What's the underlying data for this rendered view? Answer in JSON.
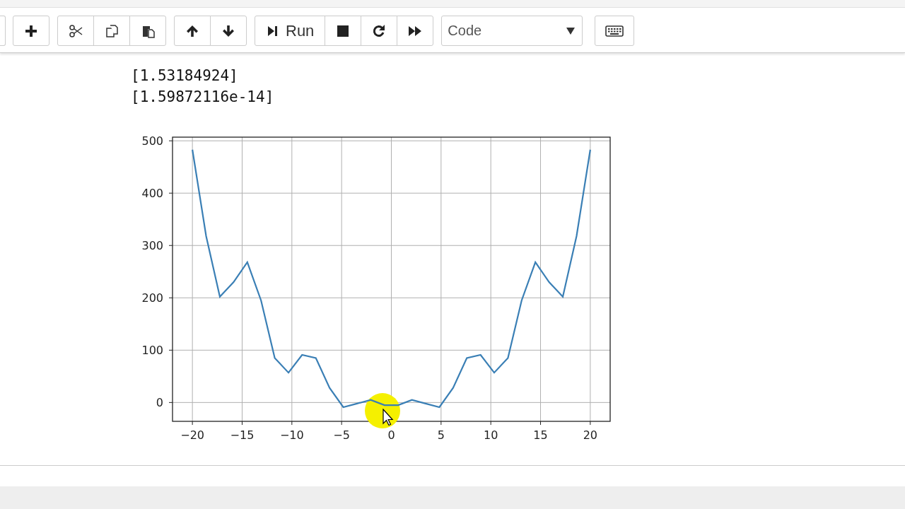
{
  "toolbar": {
    "groups": [
      [
        {
          "kind": "plus"
        }
      ],
      [
        {
          "kind": "cut"
        },
        {
          "kind": "copy"
        },
        {
          "kind": "paste"
        }
      ],
      [
        {
          "kind": "up"
        },
        {
          "kind": "down"
        }
      ],
      [
        {
          "kind": "run",
          "label": "Run"
        },
        {
          "kind": "stop"
        },
        {
          "kind": "restart"
        },
        {
          "kind": "fast-forward"
        }
      ]
    ],
    "cell_type": {
      "value": "Code"
    }
  },
  "output": {
    "lines": [
      "[1.53184924]",
      "[1.59872116e-14]"
    ],
    "chart_data": {
      "type": "line",
      "grid": true,
      "xlim": [
        -22,
        22
      ],
      "ylim": [
        -36,
        507
      ],
      "xticks": [
        {
          "value": -20,
          "label": "−20"
        },
        {
          "value": -15,
          "label": "−15"
        },
        {
          "value": -10,
          "label": "−10"
        },
        {
          "value": -5,
          "label": "−5"
        },
        0,
        5,
        10,
        15,
        20
      ],
      "yticks": [
        0,
        100,
        200,
        300,
        400,
        500
      ],
      "x": [
        -20,
        -18.62,
        -17.24,
        -15.86,
        -14.48,
        -13.1,
        -11.72,
        -10.34,
        -8.97,
        -7.59,
        -6.21,
        -4.83,
        -3.45,
        -2.07,
        -0.69,
        0.69,
        2.07,
        3.45,
        4.83,
        6.21,
        7.59,
        8.97,
        10.34,
        11.72,
        13.1,
        14.48,
        15.86,
        17.24,
        18.62,
        20
      ],
      "series": [
        {
          "color": "#3a7fb5",
          "values": [
            483,
            318,
            202,
            230,
            268,
            195,
            85,
            57,
            91,
            85,
            28,
            -9,
            -2,
            5,
            -5,
            -5,
            5,
            -2,
            -9,
            28,
            85,
            91,
            57,
            85,
            195,
            268,
            230,
            202,
            318,
            483
          ]
        }
      ]
    }
  }
}
